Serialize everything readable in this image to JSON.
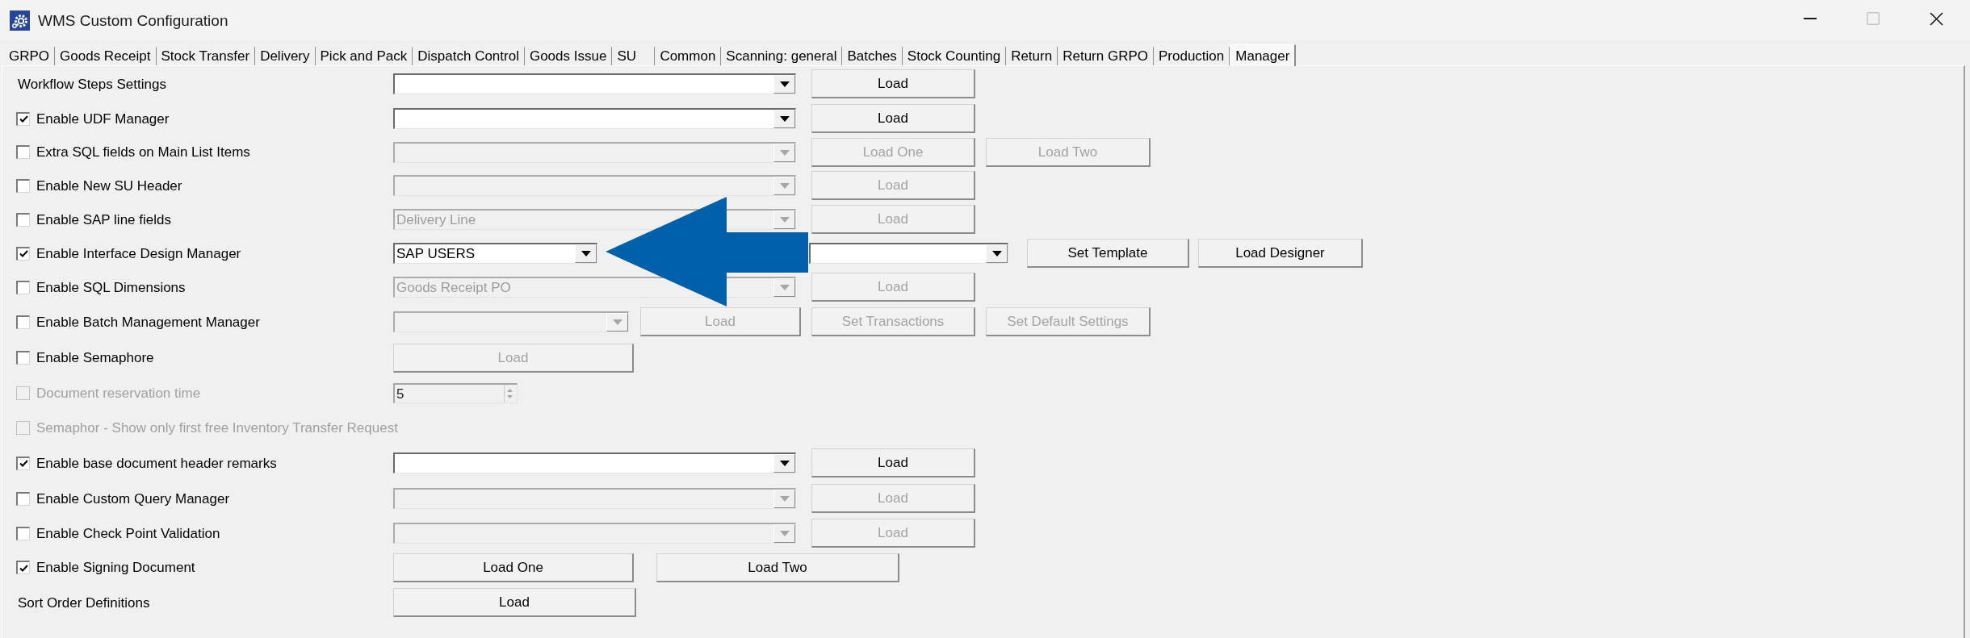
{
  "window": {
    "title": "WMS Custom Configuration",
    "controls": [
      {
        "kind": "minimize",
        "disabled": false
      },
      {
        "kind": "maximize",
        "disabled": true
      },
      {
        "kind": "close",
        "disabled": false
      }
    ]
  },
  "tabs": [
    {
      "label": "GRPO",
      "selected": false
    },
    {
      "label": "Goods Receipt",
      "selected": false
    },
    {
      "label": "Stock Transfer",
      "selected": false
    },
    {
      "label": "Delivery",
      "selected": false
    },
    {
      "label": "Pick and Pack",
      "selected": false
    },
    {
      "label": "Dispatch Control",
      "selected": false
    },
    {
      "label": "Goods Issue",
      "selected": false
    },
    {
      "label": "SU",
      "selected": false
    },
    {
      "label": "Common",
      "selected": false
    },
    {
      "label": "Scanning: general",
      "selected": false
    },
    {
      "label": "Batches",
      "selected": false
    },
    {
      "label": "Stock Counting",
      "selected": false
    },
    {
      "label": "Return",
      "selected": false
    },
    {
      "label": "Return GRPO",
      "selected": false
    },
    {
      "label": "Production",
      "selected": false
    },
    {
      "label": "Manager",
      "selected": true
    }
  ],
  "rows": [
    {
      "kind": "label",
      "label": "Workflow Steps Settings",
      "disabled": false,
      "controls": [
        {
          "kind": "dropdown",
          "disabled": false
        },
        {
          "kind": "button",
          "label": "Load",
          "disabled": false
        }
      ]
    },
    {
      "kind": "checkbox",
      "label": "Enable UDF Manager",
      "checked": true,
      "disabled": false,
      "controls": [
        {
          "kind": "dropdown",
          "disabled": false
        },
        {
          "kind": "button",
          "label": "Load",
          "disabled": false
        }
      ]
    },
    {
      "kind": "checkbox",
      "label": "Extra SQL fields on Main List Items",
      "checked": false,
      "disabled": false,
      "controls": [
        {
          "kind": "dropdown",
          "disabled": true
        },
        {
          "kind": "button",
          "label": "Load One",
          "disabled": true
        },
        {
          "kind": "button",
          "label": "Load Two",
          "disabled": true
        }
      ]
    },
    {
      "kind": "checkbox",
      "label": "Enable New SU Header",
      "checked": false,
      "disabled": false,
      "controls": [
        {
          "kind": "dropdown",
          "disabled": true
        },
        {
          "kind": "button",
          "label": "Load",
          "disabled": true
        }
      ]
    },
    {
      "kind": "checkbox",
      "label": "Enable SAP line fields",
      "checked": false,
      "disabled": false,
      "controls": [
        {
          "kind": "dropdown",
          "value": "Delivery Line",
          "disabled": true
        },
        {
          "kind": "button",
          "label": "Load",
          "disabled": true
        }
      ]
    },
    {
      "kind": "checkbox",
      "label": "Enable Interface Design Manager",
      "checked": true,
      "disabled": false,
      "controls": [
        {
          "kind": "dropdown",
          "value": "SAP USERS",
          "disabled": false
        },
        {
          "kind": "dropdown",
          "disabled": false
        },
        {
          "kind": "button",
          "label": "Set Template",
          "disabled": false
        },
        {
          "kind": "button",
          "label": "Load Designer",
          "disabled": false
        }
      ]
    },
    {
      "kind": "checkbox",
      "label": "Enable SQL Dimensions",
      "checked": false,
      "disabled": false,
      "controls": [
        {
          "kind": "dropdown",
          "value": "Goods Receipt PO",
          "disabled": true
        },
        {
          "kind": "button",
          "label": "Load",
          "disabled": true
        }
      ]
    },
    {
      "kind": "checkbox",
      "label": "Enable Batch Management Manager",
      "checked": false,
      "disabled": false,
      "controls": [
        {
          "kind": "dropdown",
          "disabled": true
        },
        {
          "kind": "button",
          "label": "Load",
          "disabled": true
        },
        {
          "kind": "button",
          "label": "Set Transactions",
          "disabled": true
        },
        {
          "kind": "button",
          "label": "Set Default Settings",
          "disabled": true
        }
      ]
    },
    {
      "kind": "checkbox",
      "label": "Enable Semaphore",
      "checked": false,
      "disabled": false,
      "controls": [
        {
          "kind": "button",
          "label": "Load",
          "disabled": true
        }
      ]
    },
    {
      "kind": "checkbox",
      "label": "Document reservation time",
      "checked": false,
      "disabled": true,
      "controls": [
        {
          "kind": "spin",
          "value": "5",
          "disabled": true
        }
      ]
    },
    {
      "kind": "checkbox",
      "label": "Semaphor - Show only first free Inventory Transfer Request",
      "checked": false,
      "disabled": true
    },
    {
      "kind": "checkbox",
      "label": "Enable base document header remarks",
      "checked": true,
      "disabled": false,
      "controls": [
        {
          "kind": "dropdown",
          "disabled": false
        },
        {
          "kind": "button",
          "label": "Load",
          "disabled": false
        }
      ]
    },
    {
      "kind": "checkbox",
      "label": "Enable Custom Query Manager",
      "checked": false,
      "disabled": false,
      "controls": [
        {
          "kind": "dropdown",
          "disabled": true
        },
        {
          "kind": "button",
          "label": "Load",
          "disabled": true
        }
      ]
    },
    {
      "kind": "checkbox",
      "label": "Enable Check Point Validation",
      "checked": false,
      "disabled": false,
      "controls": [
        {
          "kind": "dropdown",
          "disabled": true
        },
        {
          "kind": "button",
          "label": "Load",
          "disabled": true
        }
      ]
    },
    {
      "kind": "checkbox",
      "label": "Enable Signing Document",
      "checked": true,
      "disabled": false,
      "controls": [
        {
          "kind": "button",
          "label": "Load One",
          "disabled": false
        },
        {
          "kind": "button",
          "label": "Load Two",
          "disabled": false
        }
      ]
    },
    {
      "kind": "label",
      "label": "Sort Order Definitions",
      "disabled": false,
      "controls": [
        {
          "kind": "button",
          "label": "Load",
          "disabled": false
        }
      ]
    }
  ],
  "annotation": {
    "kind": "arrow"
  }
}
